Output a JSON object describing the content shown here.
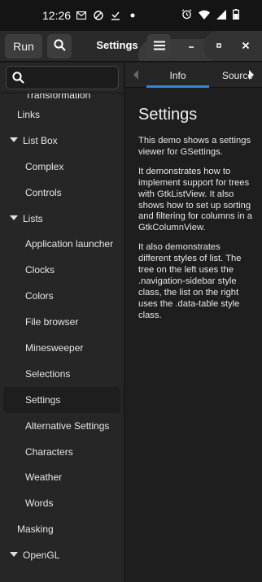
{
  "status_bar": {
    "time": "12:26",
    "left_icons": [
      "mail-icon",
      "do-not-disturb-icon",
      "download-done-icon",
      "dot-icon"
    ],
    "right_icons": [
      "alarm-icon",
      "wifi-icon",
      "signal-icon",
      "battery-icon"
    ]
  },
  "header": {
    "run_label": "Run",
    "title": "Settings",
    "minimize_glyph": "–",
    "maximize_glyph": "▫",
    "close_glyph": "✕"
  },
  "sidebar": {
    "search_placeholder": "",
    "items": [
      {
        "label": "Transformation",
        "level": 2,
        "expander": false,
        "clipped": true
      },
      {
        "label": "Links",
        "level": 1,
        "expander": false
      },
      {
        "label": "List Box",
        "level": 1,
        "expander": true
      },
      {
        "label": "Complex",
        "level": 2,
        "expander": false
      },
      {
        "label": "Controls",
        "level": 2,
        "expander": false
      },
      {
        "label": "Lists",
        "level": 1,
        "expander": true
      },
      {
        "label": "Application launcher",
        "level": 2,
        "expander": false
      },
      {
        "label": "Clocks",
        "level": 2,
        "expander": false
      },
      {
        "label": "Colors",
        "level": 2,
        "expander": false
      },
      {
        "label": "File browser",
        "level": 2,
        "expander": false
      },
      {
        "label": "Minesweeper",
        "level": 2,
        "expander": false
      },
      {
        "label": "Selections",
        "level": 2,
        "expander": false
      },
      {
        "label": "Settings",
        "level": 2,
        "expander": false,
        "selected": true
      },
      {
        "label": "Alternative Settings",
        "level": 2,
        "expander": false
      },
      {
        "label": "Characters",
        "level": 2,
        "expander": false
      },
      {
        "label": "Weather",
        "level": 2,
        "expander": false
      },
      {
        "label": "Words",
        "level": 2,
        "expander": false
      },
      {
        "label": "Masking",
        "level": 1,
        "expander": false
      },
      {
        "label": "OpenGL",
        "level": 1,
        "expander": true
      }
    ]
  },
  "tabs": {
    "info": "Info",
    "source": "Source",
    "active": "Info"
  },
  "content": {
    "title": "Settings",
    "paragraphs": [
      "This demo shows a settings viewer for GSettings.",
      "It demonstrates how to implement support for trees with GtkListView. It also shows how to set up sorting and filtering for columns in a GtkColumnView.",
      "It also demonstrates different styles of list. The tree on the left uses the .navigation-sidebar style class, the list on the right uses the .data-table style class."
    ]
  },
  "colors": {
    "accent": "#3584e4",
    "sidebar_bg": "#262626",
    "content_bg": "#1e1e1e",
    "header_bg": "#2a2a2a"
  }
}
